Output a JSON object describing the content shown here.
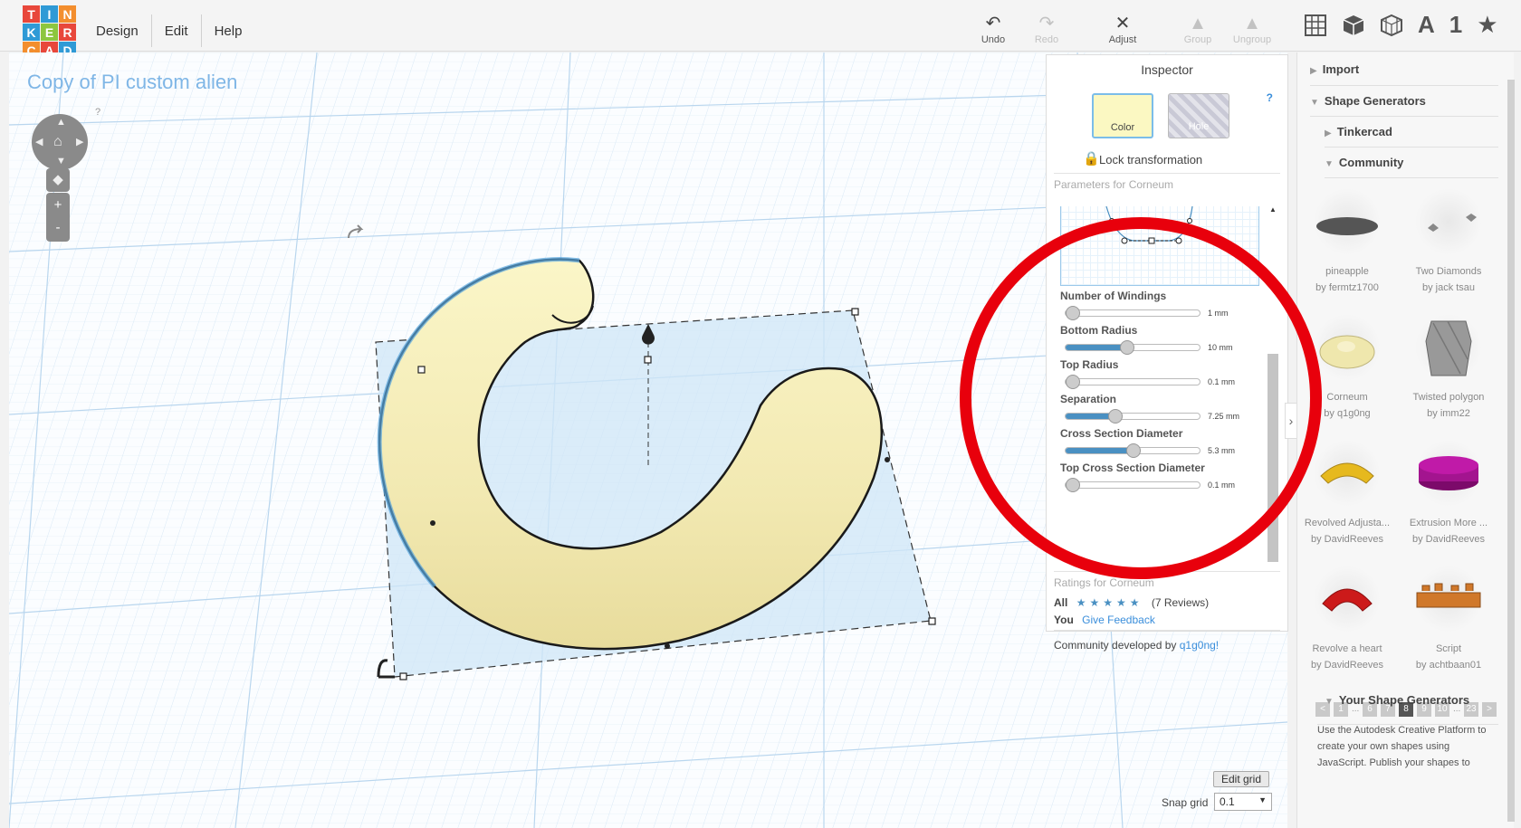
{
  "logo": {
    "letters": [
      "T",
      "I",
      "N",
      "K",
      "E",
      "R",
      "C",
      "A",
      "D"
    ],
    "colors": [
      "#e8473b",
      "#2f9ad6",
      "#f38e2e",
      "#2f9ad6",
      "#8dc63f",
      "#e8473b",
      "#f38e2e",
      "#e8473b",
      "#2f9ad6"
    ]
  },
  "menu": [
    "Design",
    "Edit",
    "Help"
  ],
  "toolbar": {
    "undo": "Undo",
    "redo": "Redo",
    "adjust": "Adjust",
    "group": "Group",
    "ungroup": "Ungroup"
  },
  "view_icons": {
    "grid_icon": "grid-view-icon",
    "box_icon": "box-view-icon",
    "wire_icon": "wireframe-icon",
    "text_icon": "A",
    "number_icon": "1",
    "star_icon": "★"
  },
  "project_title": "Copy of PI custom alien",
  "nav": {
    "help": "?",
    "zoom_in": "+",
    "zoom_out": "-"
  },
  "inspector": {
    "title": "Inspector",
    "help": "?",
    "color_label": "Color",
    "hole_label": "Hole",
    "color_value": "#fbf8c2",
    "lock_label": "Lock transformation",
    "params_header": "Parameters for Corneum",
    "params": [
      {
        "name": "Number of Windings",
        "value": "1 mm",
        "fraction": 0.0
      },
      {
        "name": "Bottom Radius",
        "value": "10 mm",
        "fraction": 0.45
      },
      {
        "name": "Top Radius",
        "value": "0.1 mm",
        "fraction": 0.0
      },
      {
        "name": "Separation",
        "value": "7.25 mm",
        "fraction": 0.35
      },
      {
        "name": "Cross Section Diameter",
        "value": "5.3 mm",
        "fraction": 0.5
      },
      {
        "name": "Top Cross Section Diameter",
        "value": "0.1 mm",
        "fraction": 0.0
      }
    ],
    "ratings_header": "Ratings for Corneum",
    "ratings_label": "All",
    "stars": "★★★★★",
    "reviews": "(7 Reviews)",
    "you_label": "You",
    "give_feedback": "Give Feedback",
    "community_text": "Community developed by",
    "community_author": "q1g0ng!"
  },
  "sidebar": {
    "import": "Import",
    "shape_generators": "Shape Generators",
    "tinkercad": "Tinkercad",
    "community": "Community",
    "cards": [
      {
        "name": "pineapple",
        "by": "by fermtz1700"
      },
      {
        "name": "Two Diamonds",
        "by": "by jack tsau"
      },
      {
        "name": "Corneum",
        "by": "by q1g0ng"
      },
      {
        "name": "Twisted polygon",
        "by": "by imm22"
      },
      {
        "name": "Revolved Adjusta...",
        "by": "by DavidReeves"
      },
      {
        "name": "Extrusion More ...",
        "by": "by DavidReeves"
      },
      {
        "name": "Revolve a heart",
        "by": "by DavidReeves"
      },
      {
        "name": "Script",
        "by": "by achtbaan01"
      }
    ],
    "pager": [
      "<",
      "1",
      "...",
      "6",
      "7",
      "8",
      "9",
      "10",
      "...",
      "23",
      ">"
    ],
    "pager_active": "8",
    "your_generators": "Your Shape Generators",
    "your_text": "Use the Autodesk Creative Platform to create your own shapes using JavaScript. Publish your shapes to"
  },
  "grid_controls": {
    "edit_grid": "Edit grid",
    "snap_label": "Snap grid",
    "snap_value": "0.1"
  }
}
